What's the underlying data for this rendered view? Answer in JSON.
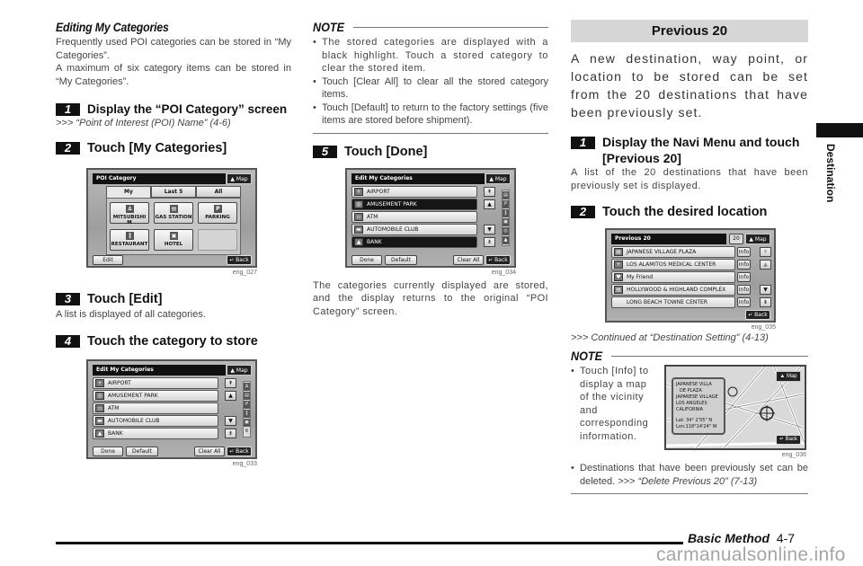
{
  "left": {
    "subtitle": "Editing My Categories",
    "para1": "Frequently used POI categories can be stored in “My Categories”.",
    "para2": "A maximum of six category items can be stored in “My Categories”.",
    "step1": {
      "num": "1",
      "title": "Display the “POI Category” screen",
      "ref": ">>> “Point of Interest (POI) Name” (4-6)"
    },
    "step2": {
      "num": "2",
      "title": "Touch [My Categories]"
    },
    "screen1": {
      "title": "POI Category",
      "map": "▲ Map",
      "tabs": [
        "My Categories",
        "Last 5",
        "All"
      ],
      "buttons": [
        {
          "label": "MITSUBISHI M",
          "icon": "∆"
        },
        {
          "label": "GAS STATION",
          "icon": "▤"
        },
        {
          "label": "PARKING",
          "icon": "P"
        },
        {
          "label": "RESTAURANT",
          "icon": "‖"
        },
        {
          "label": "HOTEL",
          "icon": "▣"
        }
      ],
      "edit": "Edit",
      "back": "↵ Back",
      "id": "eng_027"
    },
    "step3": {
      "num": "3",
      "title": "Touch [Edit]",
      "desc": "A list is displayed of all categories."
    },
    "step4": {
      "num": "4",
      "title": "Touch the category to store"
    },
    "screen2": {
      "title": "Edit My Categories",
      "map": "▲ Map",
      "rows": [
        "AIRPORT",
        "AMUSEMENT PARK",
        "ATM",
        "AUTOMOBILE CLUB",
        "BANK"
      ],
      "strip": [
        "∆",
        "▤",
        "P",
        "‖",
        "▣",
        "6"
      ],
      "done": "Done",
      "default": "Default",
      "clear_all": "Clear All",
      "back": "↵ Back",
      "id": "eng_033"
    }
  },
  "mid": {
    "note_label": "NOTE",
    "notes": [
      "The stored categories are displayed with a black highlight. Touch a stored category to clear the stored item.",
      "Touch [Clear All] to clear all the stored category items.",
      "Touch [Default] to return to the factory settings (five items are stored before shipment)."
    ],
    "step5": {
      "num": "5",
      "title": "Touch [Done]"
    },
    "screen3": {
      "title": "Edit My Categories",
      "map": "▲ Map",
      "rows": [
        {
          "label": "AIRPORT",
          "selected": false
        },
        {
          "label": "AMUSEMENT PARK",
          "selected": true
        },
        {
          "label": "ATM",
          "selected": false
        },
        {
          "label": "AUTOMOBILE CLUB",
          "selected": false
        },
        {
          "label": "BANK",
          "selected": true
        }
      ],
      "done": "Done",
      "default": "Default",
      "clear_all": "Clear All",
      "back": "↵ Back",
      "id": "eng_034"
    },
    "result": "The categories currently displayed are stored, and the display returns to the original “POI Category” screen."
  },
  "right": {
    "section": "Previous 20",
    "intro": "A new destination, way point, or location to be stored can be set from the 20 destinations that have been previously set.",
    "step1": {
      "num": "1",
      "title": "Display the Navi Menu and touch [Previous 20]",
      "desc": "A list of the 20 destinations that have been previously set is displayed."
    },
    "step2": {
      "num": "2",
      "title": "Touch the desired location"
    },
    "screen4": {
      "title": "Previous 20",
      "count": "20",
      "map": "▲ Map",
      "rows": [
        "JAPANESE VILLAGE PLAZA",
        "LOS ALAMITOS MEDICAL CENTER",
        "My Friend",
        "HOLLYWOOD & HIGHLAND COMPLEX",
        "LONG BEACH TOWNE CENTER"
      ],
      "info": "Info",
      "back": "↵ Back",
      "id": "eng_035"
    },
    "continued": ">>> Continued at “Destination Setting” (4-13)",
    "note_label": "NOTE",
    "note1": "Touch [Info] to display a map of the vicinity and corresponding information.",
    "map_screen": {
      "info_lines": [
        "JAPANESE VILLA",
        "DE PLAZA",
        "JAPANESE VILLAGE",
        "LOS ANGELES",
        "CALIFORNIA",
        "",
        "Lat:  34° 2'55\" N",
        "Lon:118°14'24\" W"
      ],
      "map": "▲ Map",
      "back": "↵ Back",
      "id": "eng_036"
    },
    "note2": "Destinations that have been previously set can be deleted. ",
    "note2_ref": ">>> “Delete Previous 20” (7-13)"
  },
  "side_tab": "Destination",
  "footer": {
    "section": "Basic Method",
    "page": "4-7"
  },
  "watermark": "carmanualsonline.info"
}
